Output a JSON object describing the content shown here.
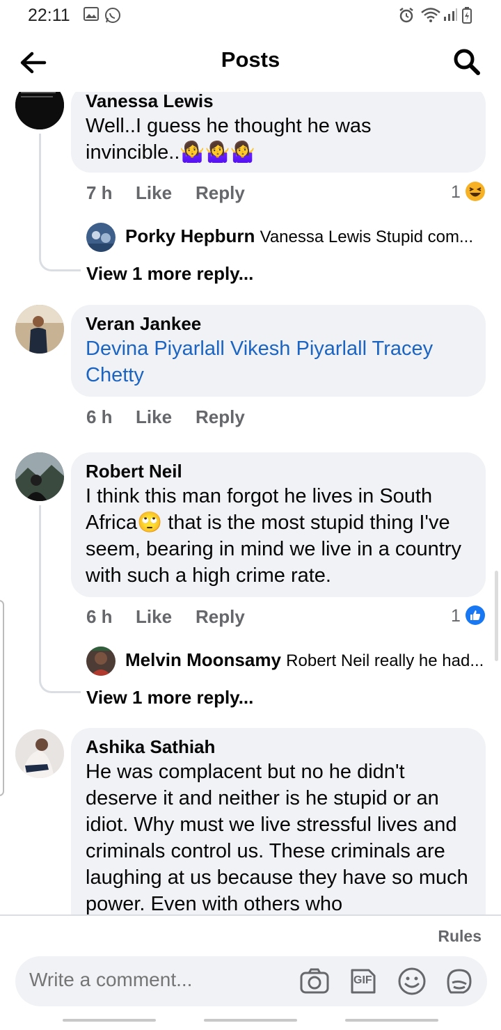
{
  "status_bar": {
    "time": "22:11"
  },
  "header": {
    "title": "Posts"
  },
  "comments": [
    {
      "author": "Vanessa Lewis",
      "text": "Well..I guess he thought he was invincible..🤷‍♀️🤷‍♀️🤷‍♀️",
      "time": "7 h",
      "like": "Like",
      "reply": "Reply",
      "reaction_count": "1",
      "reaction": "haha",
      "replies_preview": {
        "author": "Porky Hepburn",
        "text": "Vanessa Lewis Stupid com..."
      },
      "view_more": "View 1 more reply..."
    },
    {
      "author": "Veran Jankee",
      "tags": "Devina Piyarlall Vikesh Piyarlall Tracey Chetty",
      "time": "6 h",
      "like": "Like",
      "reply": "Reply"
    },
    {
      "author": "Robert Neil",
      "text": "I think this man forgot he lives in South Africa🙄  that is the most stupid thing I've seem, bearing in mind we live in a country with such a high crime rate.",
      "time": "6 h",
      "like": "Like",
      "reply": "Reply",
      "reaction_count": "1",
      "reaction": "like",
      "replies_preview": {
        "author": "Melvin Moonsamy",
        "text": "Robert Neil really he had..."
      },
      "view_more": "View 1 more reply..."
    },
    {
      "author": "Ashika Sathiah",
      "text": "He was complacent but no he didn't deserve it and neither is he stupid or an idiot. Why must we live stressful lives and criminals control us. These criminals are laughing at us because they have so much power. Even with others who"
    }
  ],
  "footer": {
    "rules": "Rules",
    "compose_placeholder": "Write a comment...",
    "gif_label": "GIF"
  },
  "colors": {
    "accent": "#1877f2",
    "tag": "#1b64c2",
    "bubble": "#f0f2f5",
    "meta": "#65676b"
  }
}
